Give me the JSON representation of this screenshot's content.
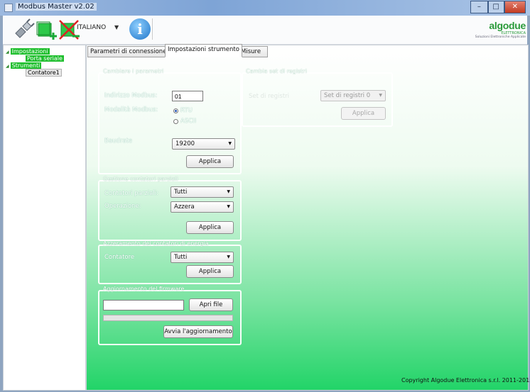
{
  "window": {
    "title": "Modbus Master v2.02"
  },
  "toolbar": {
    "icons": [
      "plug-icon",
      "connect-icon",
      "disconnect-icon"
    ],
    "language": "ITALIANO",
    "info_icon": "info-icon",
    "logo": {
      "name": "algodue",
      "sub": "ELETTRONICA",
      "tagline": "Soluzioni Elettroniche Applicate"
    }
  },
  "tree": {
    "items": [
      {
        "label": "Impostazioni"
      },
      {
        "label": "Porta seriale"
      },
      {
        "label": "Strumenti"
      },
      {
        "label": "Contatore1"
      }
    ]
  },
  "tabs": [
    "Parametri di connessione",
    "Impostazioni strumento",
    "Misure"
  ],
  "params": {
    "title": "Cambiare i parametri",
    "address_label": "Indirizzo Modbus:",
    "address_value": "01",
    "mode_label": "Modalità Modbus:",
    "mode_options": [
      "RTU",
      "ASCII"
    ],
    "mode_selected": "RTU",
    "baud_label": "Baudrate",
    "baud_value": "19200",
    "apply": "Applica"
  },
  "registers": {
    "title": "Cambia set di registri",
    "label": "Set di registri",
    "value": "Set di registri 0",
    "apply": "Applica"
  },
  "partial": {
    "title": "Gestione contatori parziali",
    "counters_label": "Contatori parziali:",
    "counters_value": "Tutti",
    "op_label": "Operazione:",
    "op_value": "Azzera",
    "apply": "Applica"
  },
  "energy": {
    "title": "Azzeramento dei contatori di energia",
    "counter_label": "Contatore",
    "counter_value": "Tutti",
    "apply": "Applica"
  },
  "firmware": {
    "title": "Aggiornamento del firmware",
    "file_value": "",
    "open": "Apri file",
    "progress": 0,
    "start": "Avvia l'aggiornamento"
  },
  "copyright": "Copyright Algodue Elettronica s.r.l. 2011-2015",
  "colors": {
    "accent_green": "#22d468",
    "tree_highlight": "#1fbf2e",
    "brand_green": "#2a9a3a"
  }
}
